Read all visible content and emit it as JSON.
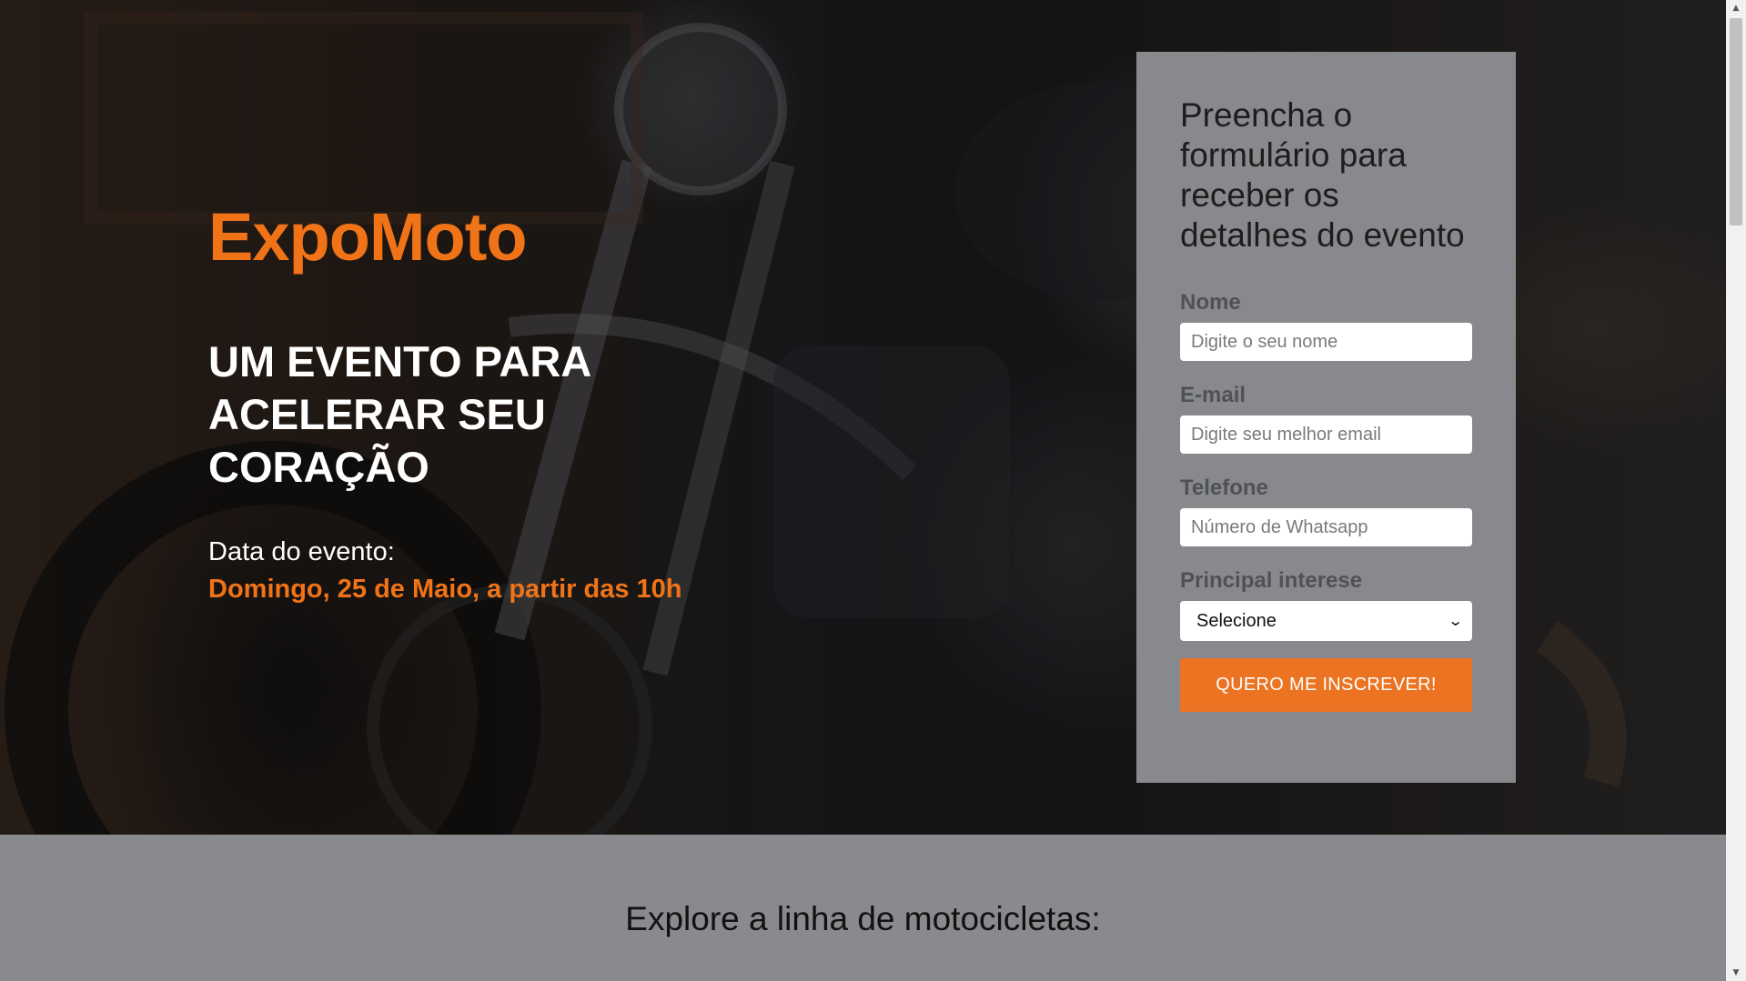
{
  "hero": {
    "brand": "ExpoMoto",
    "headline": "UM EVENTO PARA ACELERAR SEU CORAÇÃO",
    "date_label": "Data do evento:",
    "date_value": "Domingo, 25 de Maio, a partir das 10h"
  },
  "form": {
    "title": "Preencha o formulário para receber os detalhes do evento",
    "name_label": "Nome",
    "name_placeholder": "Digite o seu nome",
    "email_label": "E-mail",
    "email_placeholder": "Digite seu melhor email",
    "phone_label": "Telefone",
    "phone_placeholder": "Número de Whatsapp",
    "interest_label": "Principal interese",
    "interest_selected": "Selecione",
    "submit_label": "QUERO ME INSCREVER!"
  },
  "lower": {
    "title": "Explore a linha de motocicletas:"
  },
  "colors": {
    "accent": "#f07318",
    "button": "#ec7322",
    "card": "#87898c",
    "section_bg": "#888a8d"
  },
  "icons": {
    "select_chevron": "chevron-down-icon",
    "scroll_up": "scroll-up-arrow-icon",
    "scroll_down": "scroll-down-arrow-icon"
  }
}
